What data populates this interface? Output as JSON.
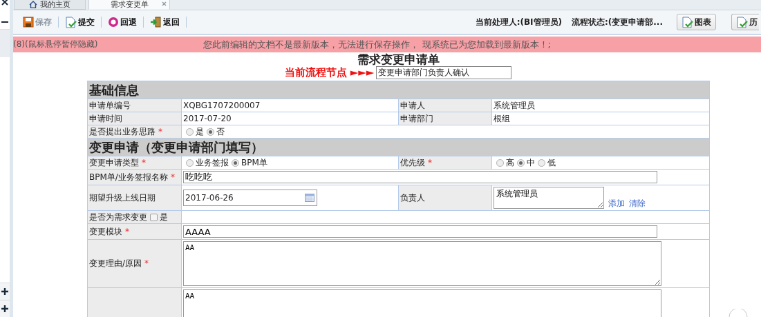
{
  "sidebar": {
    "buttons": [
      {
        "kind": "close"
      },
      {
        "kind": "collapse"
      },
      {
        "kind": "expand"
      },
      {
        "kind": "expand"
      }
    ]
  },
  "tabs": [
    {
      "label": "我的主页",
      "kind": "home",
      "selected": false,
      "closable": false
    },
    {
      "label": "需求变更单",
      "kind": "page",
      "selected": true,
      "closable": true
    }
  ],
  "toolbar": {
    "buttons": [
      {
        "label": "保存",
        "kind": "save",
        "disabled": true
      },
      {
        "label": "提交",
        "kind": "submit",
        "disabled": false
      },
      {
        "label": "回退",
        "kind": "back",
        "disabled": false
      },
      {
        "label": "返回",
        "kind": "return",
        "disabled": false
      }
    ],
    "handler": "当前处理人:(BI管理员)",
    "status": "流程状态:(变更申请部...",
    "right_buttons": [
      {
        "label": "图表"
      },
      {
        "label": "历"
      }
    ]
  },
  "notice": {
    "counter": "(8)(鼠标悬停暂停隐藏)",
    "message": "您此前编辑的文档不是最新版本，无法进行保存操作， 现系统已为您加载到最新版本！;"
  },
  "form": {
    "title": "需求变更申请单",
    "node_label": "当前流程节点 ►►►",
    "node_value": "变更申请部门负责人确认",
    "rows": [
      {
        "kind": "section",
        "title": "基础信息"
      },
      {
        "kind": "fields",
        "cells": [
          {
            "kind": "label",
            "text": "申请单编号"
          },
          {
            "kind": "text",
            "text": "XQBG1707200007"
          },
          {
            "kind": "label",
            "text": "申请人"
          },
          {
            "kind": "text",
            "text": "系统管理员"
          }
        ]
      },
      {
        "kind": "fields",
        "cells": [
          {
            "kind": "label",
            "text": "申请时间"
          },
          {
            "kind": "text",
            "text": "2017-07-20"
          },
          {
            "kind": "label",
            "text": "申请部门"
          },
          {
            "kind": "text",
            "text": "根组"
          }
        ]
      },
      {
        "kind": "fields",
        "cells": [
          {
            "kind": "label",
            "text": "是否提出业务思路",
            "mark": "*"
          },
          {
            "kind": "radio",
            "options": [
              {
                "label": "是",
                "selected": false
              },
              {
                "label": "否",
                "selected": true
              }
            ]
          }
        ]
      },
      {
        "kind": "section",
        "title": "变更申请（变更申请部门填写）"
      },
      {
        "kind": "fields",
        "cells": [
          {
            "kind": "label",
            "text": "变更申请类型",
            "mark": "*"
          },
          {
            "kind": "radio",
            "options": [
              {
                "label": "业务签报",
                "selected": false
              },
              {
                "label": "BPM单",
                "selected": true
              }
            ]
          },
          {
            "kind": "label",
            "text": "优先级",
            "mark": "*"
          },
          {
            "kind": "radio",
            "options": [
              {
                "label": "高",
                "selected": false
              },
              {
                "label": "中",
                "selected": true
              },
              {
                "label": "低",
                "selected": false
              }
            ]
          }
        ]
      },
      {
        "kind": "fields",
        "cells": [
          {
            "kind": "label",
            "text": "BPM单/业务签报名称",
            "mark": "*"
          },
          {
            "kind": "input",
            "value": "吃吃吃"
          }
        ]
      },
      {
        "kind": "fields",
        "cells": [
          {
            "kind": "label",
            "text": "期望升级上线日期"
          },
          {
            "kind": "date",
            "value": "2017-06-26"
          },
          {
            "kind": "label",
            "text": "负责人"
          },
          {
            "kind": "people",
            "value": "系统管理员",
            "links": [
              "添加",
              "清除"
            ]
          }
        ]
      },
      {
        "kind": "fields",
        "cells": [
          {
            "kind": "check_label",
            "text": "是否为需求变更",
            "option": "是",
            "checked": false
          },
          {
            "kind": "empty"
          }
        ]
      },
      {
        "kind": "fields",
        "cells": [
          {
            "kind": "label",
            "text": "变更模块",
            "mark": "*"
          },
          {
            "kind": "input",
            "value": "AAAA"
          }
        ]
      },
      {
        "kind": "fields",
        "cells": [
          {
            "kind": "label",
            "text": "变更理由/原因",
            "mark": "*"
          },
          {
            "kind": "textarea",
            "value": "AA"
          }
        ]
      },
      {
        "kind": "fields",
        "cells": [
          {
            "kind": "blank"
          },
          {
            "kind": "textarea",
            "value": "AA"
          }
        ]
      }
    ]
  }
}
